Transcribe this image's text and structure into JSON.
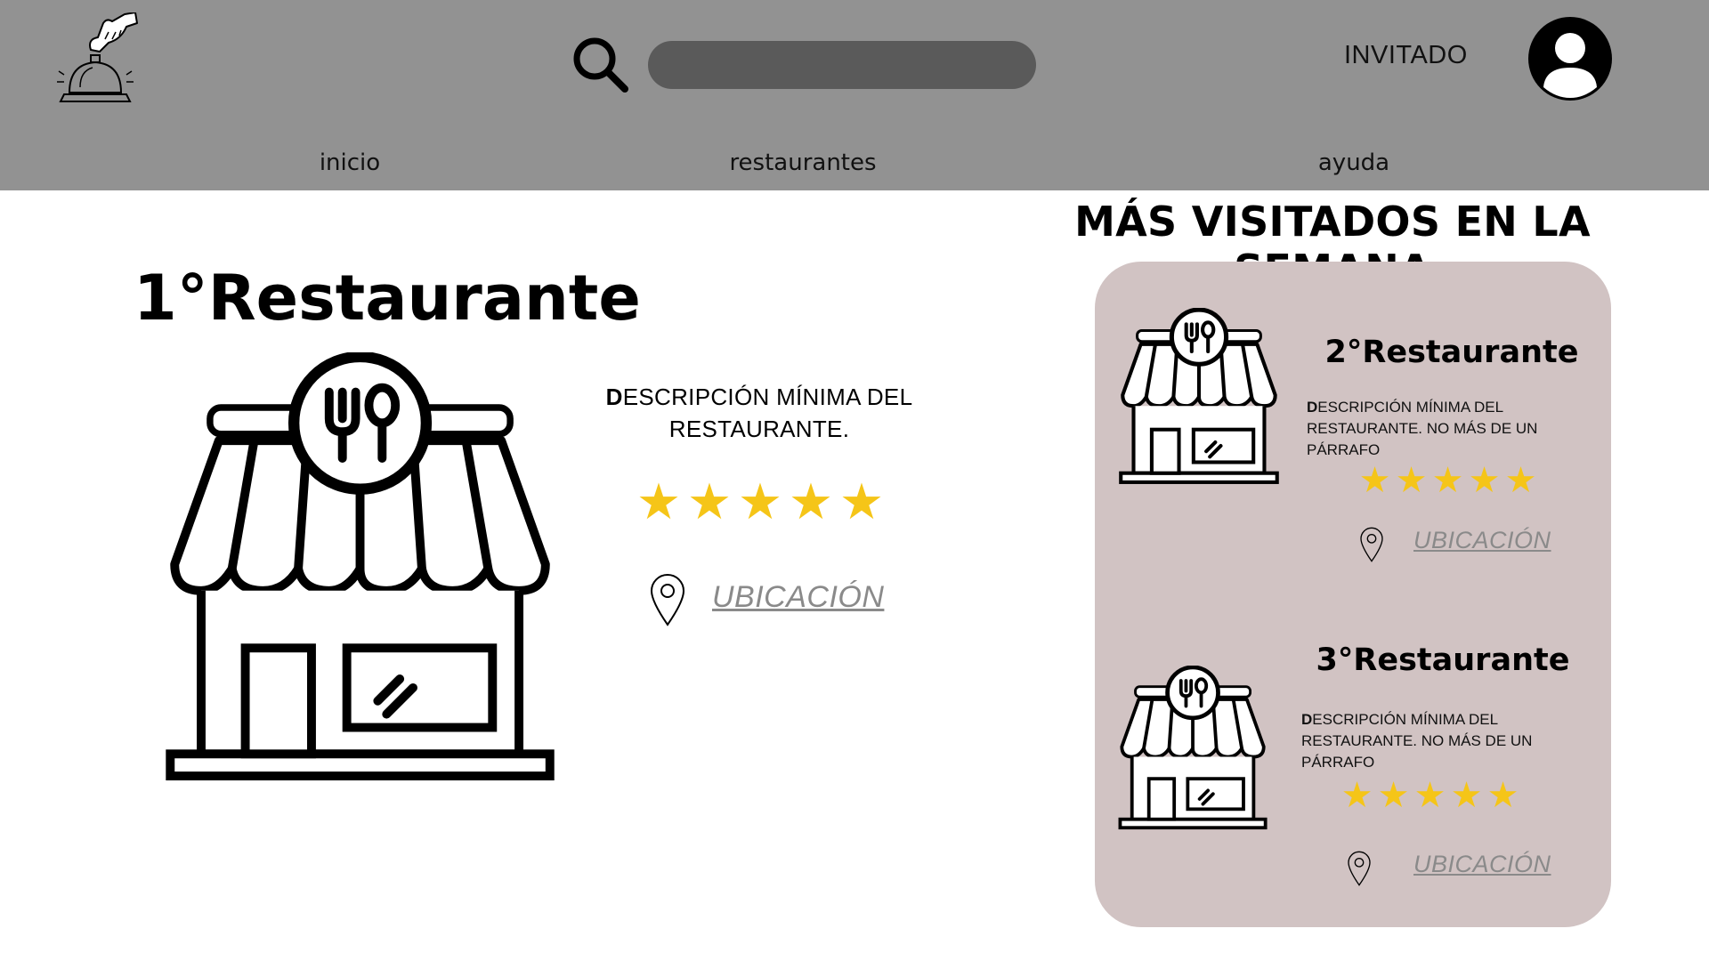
{
  "header": {
    "logo_icon": "service-bell-icon",
    "search": {
      "icon": "search-icon",
      "placeholder": "",
      "value": ""
    },
    "guest_label": "INVITADO",
    "avatar_icon": "user-avatar-icon",
    "nav": [
      {
        "label": "inicio"
      },
      {
        "label": "restaurantes"
      },
      {
        "label": "ayuda"
      }
    ]
  },
  "section_title": "MÁS VISITADOS EN LA SEMANA",
  "featured": {
    "title": "1°Restaurante",
    "description_first": "D",
    "description_rest": "ESCRIPCIÓN MÍNIMA DEL RESTAURANTE.",
    "rating": 5,
    "stars": [
      "★",
      "★",
      "★",
      "★",
      "★"
    ],
    "location_label": "UBICACIÓN"
  },
  "cards": [
    {
      "title": "2°Restaurante",
      "description_first": "D",
      "description_rest": "ESCRIPCIÓN MÍNIMA DEL RESTAURANTE. NO MÁS DE UN PÁRRAFO",
      "rating": 5,
      "location_label": "UBICACIÓN"
    },
    {
      "title": "3°Restaurante",
      "description_first": "D",
      "description_rest": "ESCRIPCIÓN MÍNIMA DEL RESTAURANTE. NO MÁS DE UN PÁRRAFO",
      "rating": 5,
      "location_label": "UBICACIÓN"
    }
  ],
  "colors": {
    "header_bg": "#929292",
    "search_bg": "#5a5a5a",
    "card_bg": "#d1c3c3",
    "star": "#f5c518",
    "link": "#8a8a8a"
  }
}
